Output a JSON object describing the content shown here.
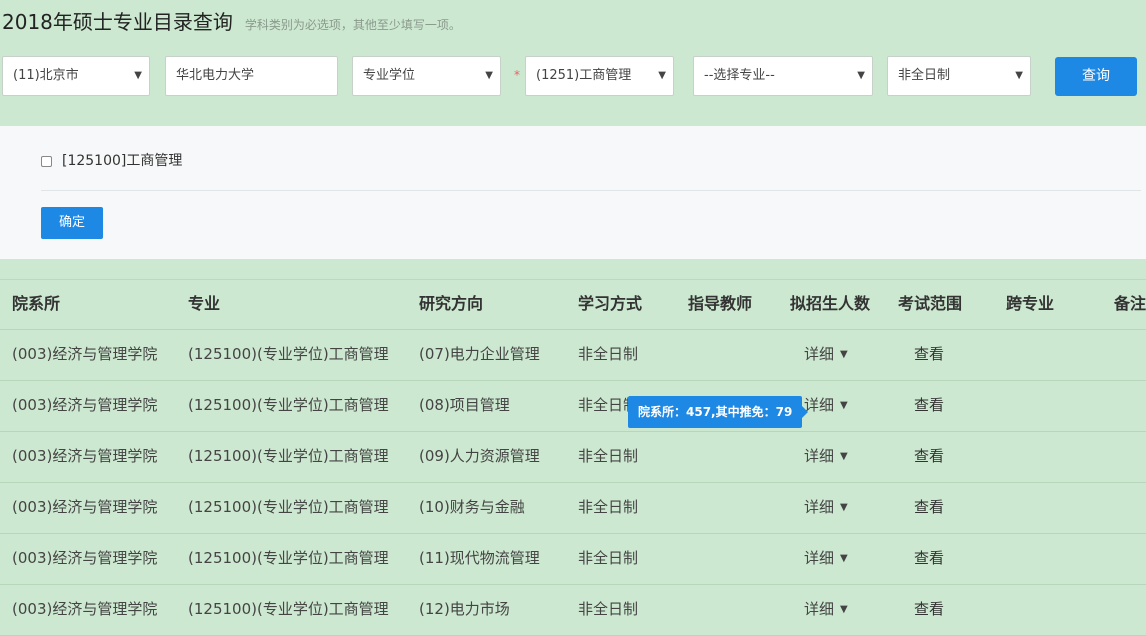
{
  "header": {
    "title": "2018年硕士专业目录查询",
    "hint": "学科类别为必选项，其他至少填写一项。"
  },
  "filters": {
    "region": "(11)北京市",
    "school": "华北电力大学",
    "degree_type": "专业学位",
    "required_mark": "*",
    "discipline": "(1251)工商管理",
    "major_placeholder": "--选择专业--",
    "study_mode": "非全日制",
    "query_button": "查询",
    "caret": "▼"
  },
  "major_panel": {
    "checkbox_label": "[125100]工商管理",
    "confirm_button": "确定"
  },
  "table": {
    "headers": [
      "院系所",
      "专业",
      "研究方向",
      "学习方式",
      "指导教师",
      "拟招生人数",
      "考试范围",
      "跨专业",
      "备注"
    ],
    "rows": [
      {
        "dept": "(003)经济与管理学院",
        "major": "(125100)(专业学位)工商管理",
        "direction": "(07)电力企业管理",
        "mode": "非全日制",
        "detail": "详细",
        "exam": "查看"
      },
      {
        "dept": "(003)经济与管理学院",
        "major": "(125100)(专业学位)工商管理",
        "direction": "(08)项目管理",
        "mode": "非全日制",
        "detail": "详细",
        "exam": "查看"
      },
      {
        "dept": "(003)经济与管理学院",
        "major": "(125100)(专业学位)工商管理",
        "direction": "(09)人力资源管理",
        "mode": "非全日制",
        "detail": "详细",
        "exam": "查看"
      },
      {
        "dept": "(003)经济与管理学院",
        "major": "(125100)(专业学位)工商管理",
        "direction": "(10)财务与金融",
        "mode": "非全日制",
        "detail": "详细",
        "exam": "查看"
      },
      {
        "dept": "(003)经济与管理学院",
        "major": "(125100)(专业学位)工商管理",
        "direction": "(11)现代物流管理",
        "mode": "非全日制",
        "detail": "详细",
        "exam": "查看"
      },
      {
        "dept": "(003)经济与管理学院",
        "major": "(125100)(专业学位)工商管理",
        "direction": "(12)电力市场",
        "mode": "非全日制",
        "detail": "详细",
        "exam": "查看"
      }
    ]
  },
  "tooltip": {
    "text": "院系所：457,其中推免：79"
  },
  "colors": {
    "background": "#cde8d0",
    "accent": "#1e88e5",
    "panel": "#f7f8f9"
  }
}
